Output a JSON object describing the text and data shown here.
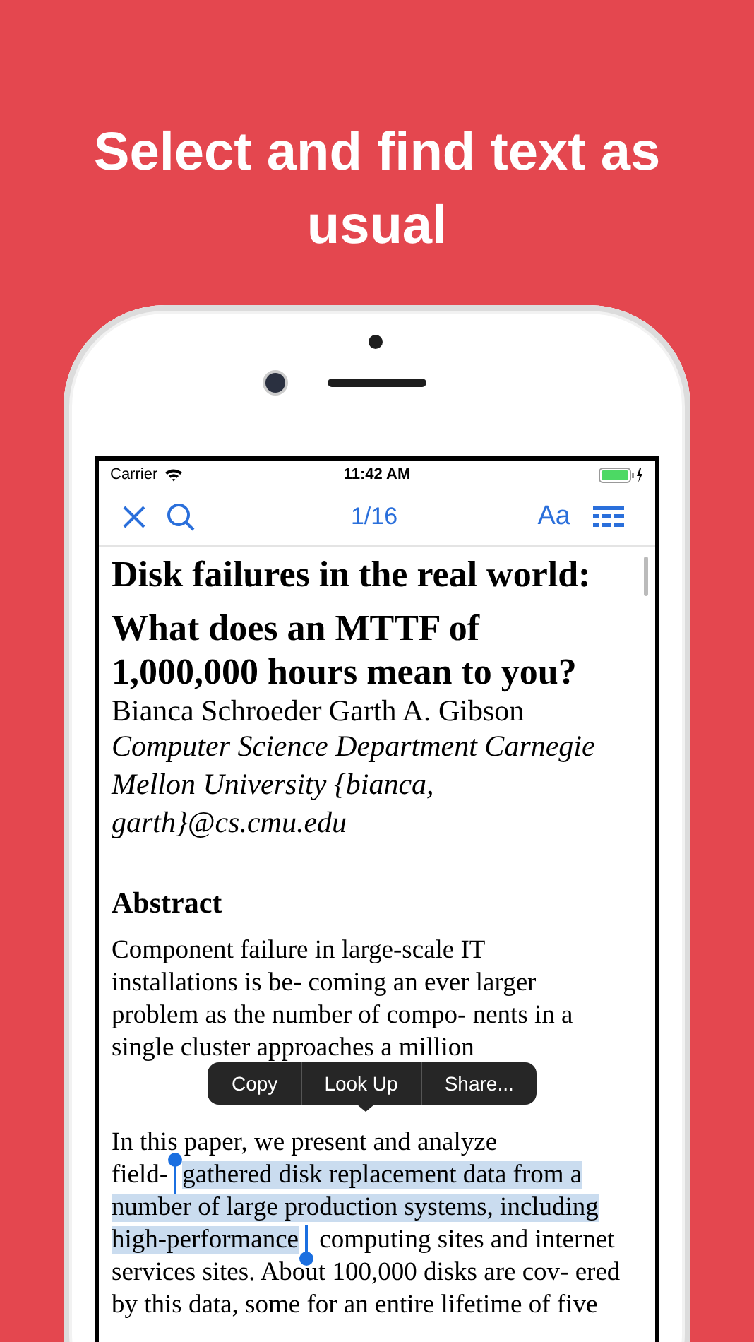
{
  "headline": "Select and find text as usual",
  "status_bar": {
    "carrier": "Carrier",
    "time": "11:42 AM"
  },
  "toolbar": {
    "page": "1/16",
    "font_button": "Aa"
  },
  "document": {
    "blocks": [
      {
        "kind": "title",
        "lines": [
          "Disk failures in the real world:"
        ]
      },
      {
        "kind": "title",
        "lines": [
          "What does an MTTF of",
          "1,000,000 hours mean to you?"
        ]
      },
      {
        "kind": "authors",
        "lines": [
          "Bianca Schroeder  Garth A. Gibson"
        ]
      },
      {
        "kind": "affiliation",
        "lines": [
          "Computer Science Department Carnegie",
          "Mellon University {bianca,",
          "garth}@cs.cmu.edu"
        ]
      },
      {
        "kind": "heading",
        "lines": [
          "Abstract"
        ]
      },
      {
        "kind": "paragraph",
        "rows": [
          [
            {
              "text": "Component failure in large-scale IT",
              "selected": false
            }
          ],
          [
            {
              "text": "installations is be- coming an ever larger",
              "selected": false
            }
          ],
          [
            {
              "text": "problem as the number of compo- nents in a",
              "selected": false
            }
          ],
          [
            {
              "text": "single cluster approaches a million",
              "selected": false
            }
          ]
        ]
      },
      {
        "kind": "paragraph",
        "rows": [
          [
            {
              "text": "In this paper, we present and analyze",
              "selected": false
            }
          ],
          [
            {
              "text": "field-",
              "selected": false
            },
            {
              "text": "gathered disk replacement data from a",
              "selected": true
            }
          ],
          [
            {
              "text": "number of large production systems,  including",
              "selected": true
            }
          ],
          [
            {
              "text": "high-performance",
              "selected": true
            },
            {
              "text": " computing  sites and internet",
              "selected": false
            }
          ],
          [
            {
              "text": "services sites. About 100,000 disks are cov- ered",
              "selected": false
            }
          ],
          [
            {
              "text": "by this data, some for an entire lifetime of five",
              "selected": false
            }
          ]
        ]
      }
    ]
  },
  "context_menu": {
    "items": [
      "Copy",
      "Look Up",
      "Share..."
    ]
  }
}
